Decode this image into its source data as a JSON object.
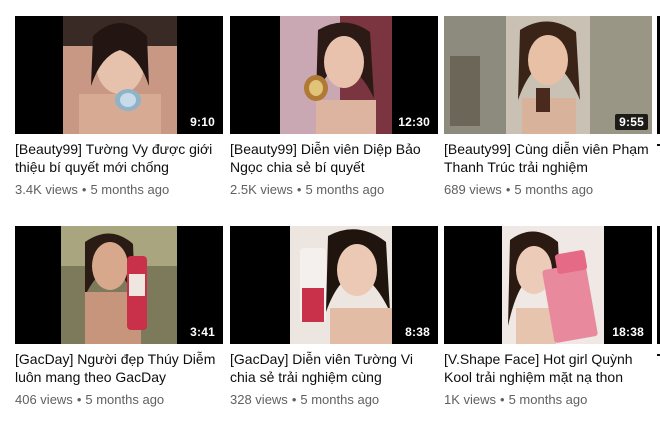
{
  "videos": [
    {
      "title": "[Beauty99] Tường Vy được giới thiệu bí quyết mới chống",
      "duration": "9:10",
      "views": "3.4K views",
      "age": "5 months ago"
    },
    {
      "title": "[Beauty99] Diễn viên Diệp Bảo Ngọc chia sẻ bí quyết",
      "duration": "12:30",
      "views": "2.5K views",
      "age": "5 months ago"
    },
    {
      "title": "[Beauty99] Cùng diễn viên Phạm Thanh Trúc trải nghiệm",
      "duration": "9:55",
      "views": "689 views",
      "age": "5 months ago"
    },
    {
      "title": "[GacDay] Người đẹp Thúy Diễm luôn mang theo GacDay",
      "duration": "3:41",
      "views": "406 views",
      "age": "5 months ago"
    },
    {
      "title": "[GacDay] Diễn viên Tường Vi chia sẻ trải nghiệm cùng",
      "duration": "8:38",
      "views": "328 views",
      "age": "5 months ago"
    },
    {
      "title": "[V.Shape Face] Hot girl Quỳnh Kool trải nghiệm mặt nạ thon",
      "duration": "18:38",
      "views": "1K views",
      "age": "5 months ago"
    }
  ],
  "separator": "•",
  "colors": {
    "thumb_bg": "#000000",
    "title": "#0d0d0d",
    "meta": "#606060",
    "overlay": "#000000"
  }
}
